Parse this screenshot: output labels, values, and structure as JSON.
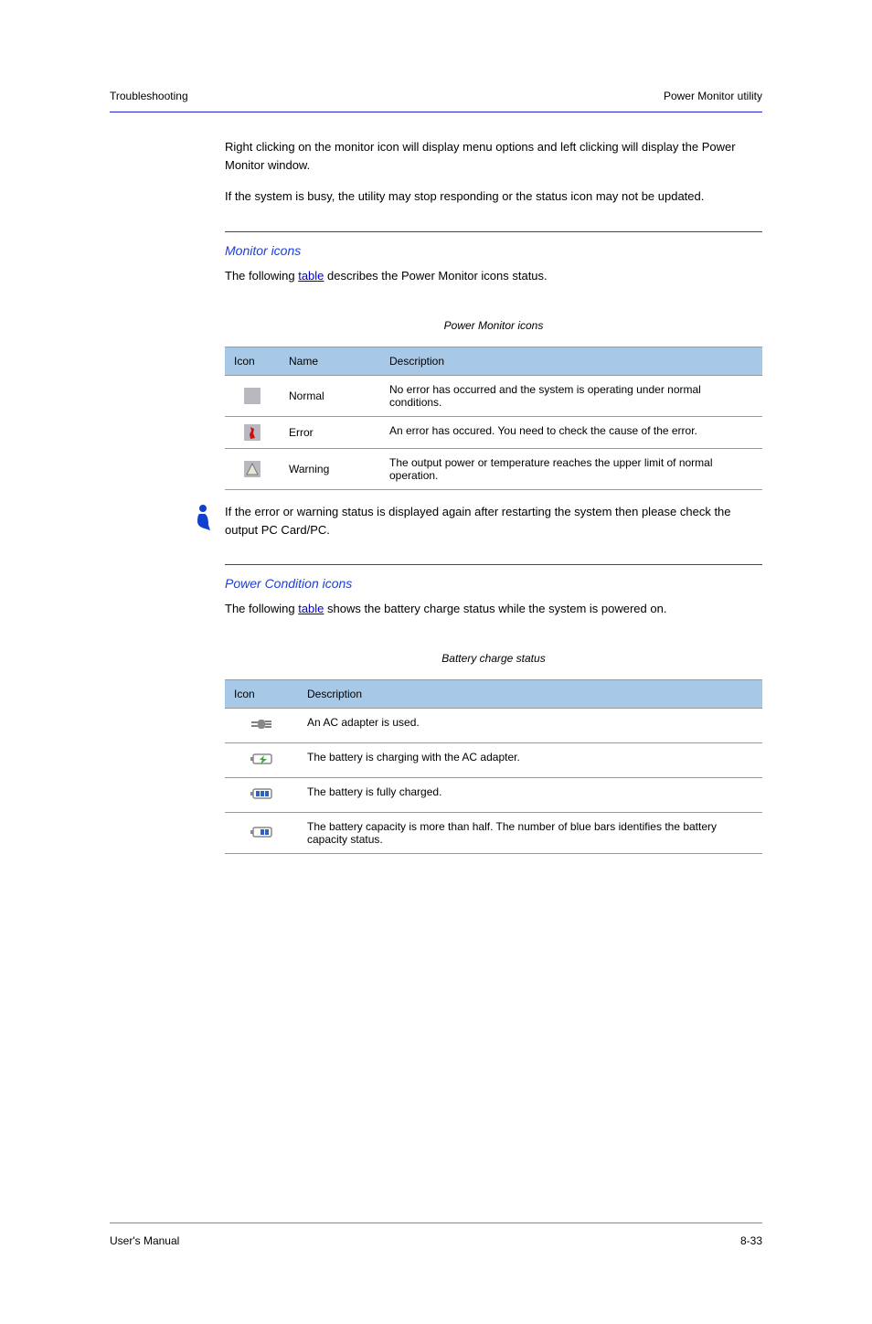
{
  "header": {
    "left": "Troubleshooting",
    "right": "Power Monitor utility"
  },
  "para1": "Right clicking on the monitor icon will display menu options and left clicking will display the Power Monitor window.",
  "para2": "If the system is busy, the utility may stop responding or the status icon may not be updated.",
  "subsection1": {
    "title": "Monitor icons",
    "intro_pre": "The following ",
    "intro_link": "table",
    "intro_post": " describes the Power Monitor icons status.",
    "caption": "Power Monitor icons"
  },
  "table1": {
    "headers": [
      "Icon",
      "Name",
      "Description"
    ],
    "rows": [
      {
        "name": "Normal",
        "desc": "No error has occurred and the system is operating under normal conditions."
      },
      {
        "name": "Error",
        "desc": "An error has occured. You need to check the cause of the error."
      },
      {
        "name": "Warning",
        "desc": "The output power or temperature reaches the upper limit of normal operation."
      }
    ]
  },
  "note": "If the error or warning status is displayed again after restarting the system then please check the output PC Card/PC.",
  "subsection2": {
    "title": "Power Condition icons",
    "intro_pre": "The following ",
    "intro_link": "table",
    "intro_post": " shows the battery charge status while the system is powered on.",
    "caption": "Battery charge status"
  },
  "table2": {
    "headers": [
      "Icon",
      "Description"
    ],
    "rows": [
      {
        "desc": "An AC adapter is used."
      },
      {
        "desc": "The battery is charging with the AC adapter."
      },
      {
        "desc": "The battery is fully charged."
      },
      {
        "desc": "The battery capacity is more than half. The number of blue bars identifies the battery capacity status."
      }
    ]
  },
  "footer": {
    "left": "User's Manual",
    "right": "8-33"
  },
  "icons": {
    "normal": "normal-square",
    "error": "error-square",
    "warning": "warning-square",
    "ac": "ac-plug-icon",
    "charging": "charging-battery-icon",
    "full": "full-battery-icon",
    "half": "half-battery-icon",
    "note": "person-note-icon"
  }
}
